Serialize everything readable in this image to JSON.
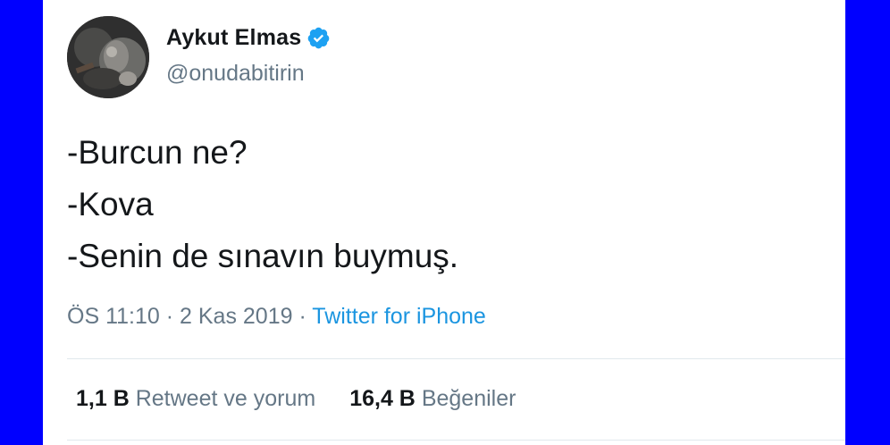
{
  "tweet": {
    "author": {
      "display_name": "Aykut Elmas",
      "handle": "@onudabitirin",
      "verified_icon": "verified-badge-icon",
      "avatar": "profile-photo"
    },
    "lines": [
      "-Burcun ne?",
      "-Kova",
      "-Senin de sınavın buymuş."
    ],
    "meta": {
      "time": "ÖS 11:10",
      "separator": "·",
      "date": "2 Kas 2019",
      "source": "Twitter for iPhone"
    },
    "stats": {
      "retweets_count": "1,1 B",
      "retweets_label": "Retweet ve yorum",
      "likes_count": "16,4 B",
      "likes_label": "Beğeniler"
    }
  },
  "colors": {
    "background": "#0000ff",
    "card": "#ffffff",
    "text_primary": "#14171a",
    "text_secondary": "#657786",
    "link": "#1b95e0",
    "verified": "#1da1f2",
    "divider": "#e1e8ed"
  }
}
